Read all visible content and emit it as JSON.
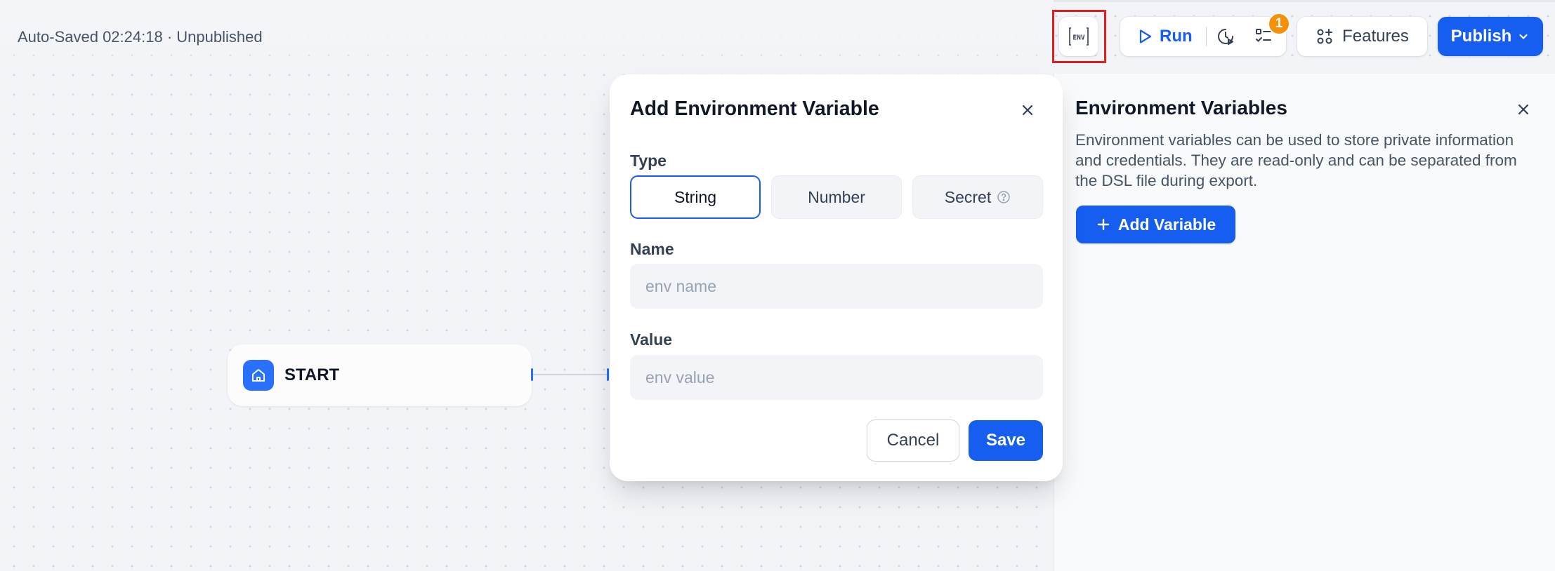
{
  "header": {
    "autosave_status": "Auto-Saved 02:24:18 · Unpublished",
    "env_button_icon": "env-icon",
    "run_label": "Run",
    "issues_badge_count": "1",
    "features_label": "Features",
    "publish_label": "Publish",
    "highlight_color": "#e02020"
  },
  "workflow": {
    "start_node_label": "START",
    "node_accent_color": "#2970ff"
  },
  "env_panel": {
    "title": "Environment Variables",
    "description": "Environment variables can be used to store private information and credentials. They are read-only and can be separated from the DSL file during export.",
    "add_button_label": "Add Variable"
  },
  "modal": {
    "title": "Add Environment Variable",
    "type_label": "Type",
    "types": [
      "String",
      "Number",
      "Secret"
    ],
    "selected_type": "String",
    "name_label": "Name",
    "name_placeholder": "env name",
    "value_label": "Value",
    "value_placeholder": "env value",
    "cancel_label": "Cancel",
    "save_label": "Save"
  },
  "colors": {
    "primary": "#155eef",
    "badge": "#f79009"
  }
}
